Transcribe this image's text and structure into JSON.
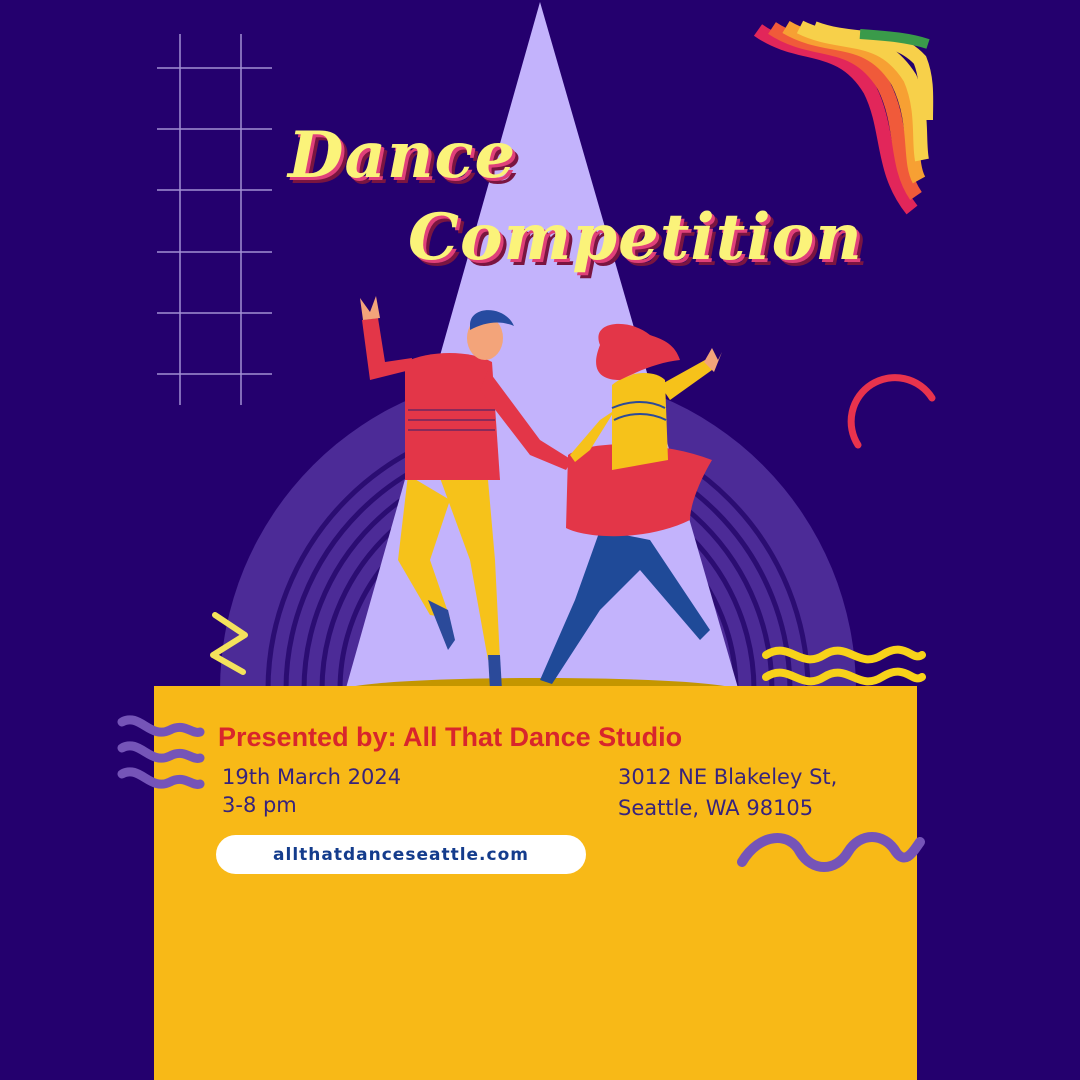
{
  "title": {
    "line1": "Dance",
    "line2": "Competition"
  },
  "event": {
    "presented_by": "Presented by: All That Dance Studio",
    "date": "19th March 2024",
    "time": "3-8 pm",
    "address_line1": "3012 NE Blakeley St,",
    "address_line2": "Seattle, WA 98105",
    "website": "allthatdanceseattle.com"
  },
  "colors": {
    "background": "#24006e",
    "spotlight": "#c3b3fc",
    "panel": "#f8b917",
    "title": "#fbf37a",
    "accent_red": "#d8262c",
    "text": "#37237c"
  },
  "decorations": [
    "grid-decoration",
    "rainbow-ribbon",
    "red-arc",
    "yellow-squiggle",
    "purple-waves",
    "zigzag",
    "dancing-couple"
  ]
}
